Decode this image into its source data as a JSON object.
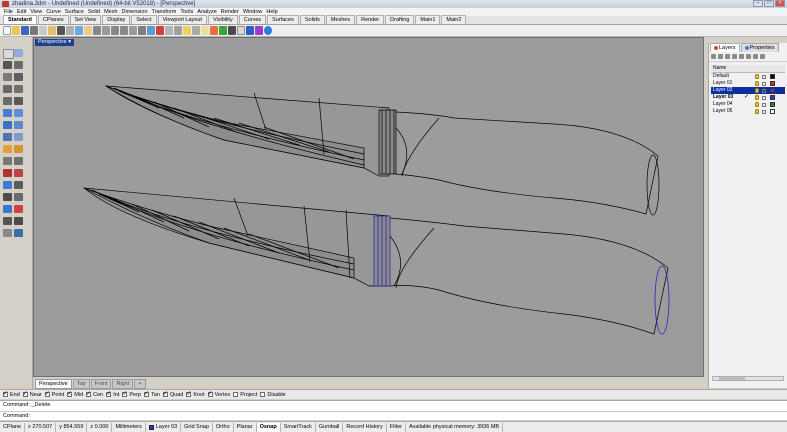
{
  "window": {
    "title": "zhadina.3dm - Undefined (Undefined) (64-bit V52018) - [Perspective]"
  },
  "menu": [
    "File",
    "Edit",
    "View",
    "Curve",
    "Surface",
    "Solid",
    "Mesh",
    "Dimension",
    "Transform",
    "Tools",
    "Analyze",
    "Render",
    "Window",
    "Help"
  ],
  "toolbar_tabs": [
    "Standard",
    "CPlanes",
    "Set View",
    "Display",
    "Select",
    "Viewport Layout",
    "Visibility",
    "Curves",
    "Surfaces",
    "Solids",
    "Meshes",
    "Render",
    "Drafting",
    "Main1",
    "Main2"
  ],
  "viewport": {
    "label": "Perspective ▾"
  },
  "viewport_tabs": [
    "Perspective",
    "Top",
    "Front",
    "Right",
    "+"
  ],
  "panel": {
    "tabs": [
      "Layers",
      "Properties"
    ],
    "header": "Name",
    "layers": [
      {
        "name": "Default",
        "check": "",
        "color": "#000000"
      },
      {
        "name": "Layer 01",
        "check": "",
        "color": "#d42a2a"
      },
      {
        "name": "Layer 02",
        "check": "",
        "color": "#6b2bd6"
      },
      {
        "name": "Layer 03",
        "check": "✓",
        "color": "#1f3ad6"
      },
      {
        "name": "Layer 04",
        "check": "",
        "color": "#1e8a2e"
      },
      {
        "name": "Layer 05",
        "check": "",
        "color": "#ffffff"
      }
    ]
  },
  "osnaps": [
    {
      "label": "End",
      "checked": true
    },
    {
      "label": "Near",
      "checked": true
    },
    {
      "label": "Point",
      "checked": true
    },
    {
      "label": "Mid",
      "checked": true
    },
    {
      "label": "Cen",
      "checked": true
    },
    {
      "label": "Int",
      "checked": true
    },
    {
      "label": "Perp",
      "checked": true
    },
    {
      "label": "Tan",
      "checked": true
    },
    {
      "label": "Quad",
      "checked": true
    },
    {
      "label": "Knot",
      "checked": true
    },
    {
      "label": "Vertex",
      "checked": true
    },
    {
      "label": "Project",
      "checked": false
    },
    {
      "label": "Disable",
      "checked": false
    }
  ],
  "command": {
    "history": "Command: _Delete",
    "prompt": "Command:"
  },
  "status": {
    "cplane": "CPlane",
    "x": "x 270.507",
    "y": "y 854.559",
    "z": "z 0.000",
    "units": "Millimeters",
    "layer": "Layer 03",
    "toggles": [
      "Grid Snap",
      "Ortho",
      "Planar",
      "Osnap",
      "SmartTrack",
      "Gumball",
      "Record History",
      "Filter"
    ],
    "memory": "Available physical memory: 3936 MB"
  }
}
